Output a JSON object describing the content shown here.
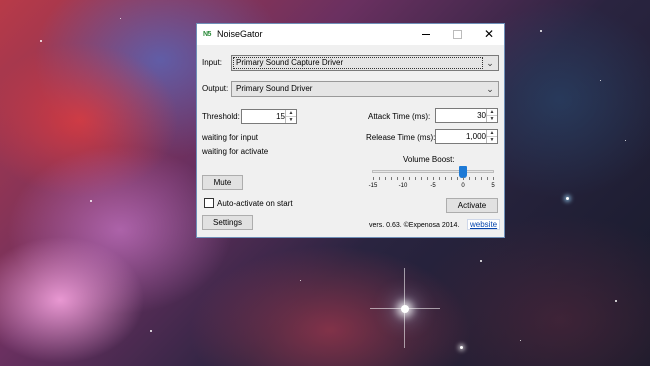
{
  "window": {
    "title": "NoiseGator",
    "app_icon": "N5"
  },
  "input": {
    "label": "Input:",
    "value": "Primary Sound Capture Driver"
  },
  "output": {
    "label": "Output:",
    "value": "Primary Sound Driver"
  },
  "threshold": {
    "label": "Threshold:",
    "value": "15"
  },
  "attack": {
    "label": "Attack Time (ms):",
    "value": "30"
  },
  "release": {
    "label": "Release Time (ms):",
    "value": "1,000"
  },
  "status": {
    "line1": "waiting for input",
    "line2": "waiting for activate"
  },
  "volume_boost": {
    "label": "Volume Boost:",
    "value": 0,
    "min": -15,
    "max": 5,
    "tick_labels": [
      "-15",
      "-10",
      "-5",
      "0",
      "5"
    ]
  },
  "buttons": {
    "mute": "Mute",
    "activate": "Activate",
    "settings": "Settings"
  },
  "auto_activate": {
    "label": "Auto-activate on start",
    "checked": false
  },
  "footer": {
    "version": "vers. 0.63. ©Expenosa 2014.",
    "website": "website"
  },
  "colors": {
    "slider_thumb": "#1e7ad6",
    "link": "#0645ad"
  }
}
